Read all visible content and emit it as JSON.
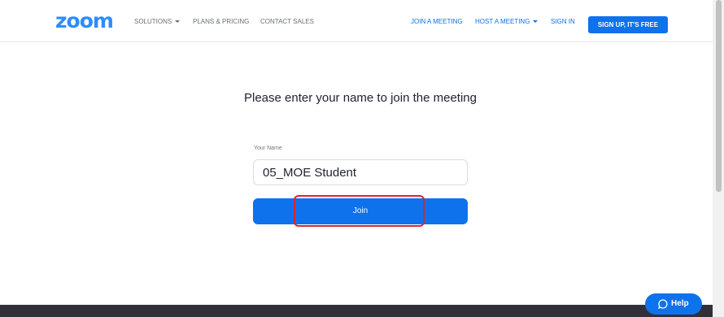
{
  "header": {
    "logo_text": "zoom",
    "nav": {
      "solutions": "SOLUTIONS",
      "plans": "PLANS & PRICING",
      "contact": "CONTACT SALES",
      "join_meeting": "JOIN A MEETING",
      "host_meeting": "HOST A MEETING",
      "sign_in": "SIGN IN",
      "sign_up": "SIGN UP, IT'S FREE"
    }
  },
  "main": {
    "heading": "Please enter your name to join the meeting",
    "name_label": "Your Name",
    "name_value": "05_MOE Student",
    "join_label": "Join"
  },
  "help": {
    "label": "Help"
  },
  "colors": {
    "brand": "#2d8cff",
    "primary": "#0e72ed",
    "highlight": "#e0232b",
    "footer": "#313039"
  }
}
